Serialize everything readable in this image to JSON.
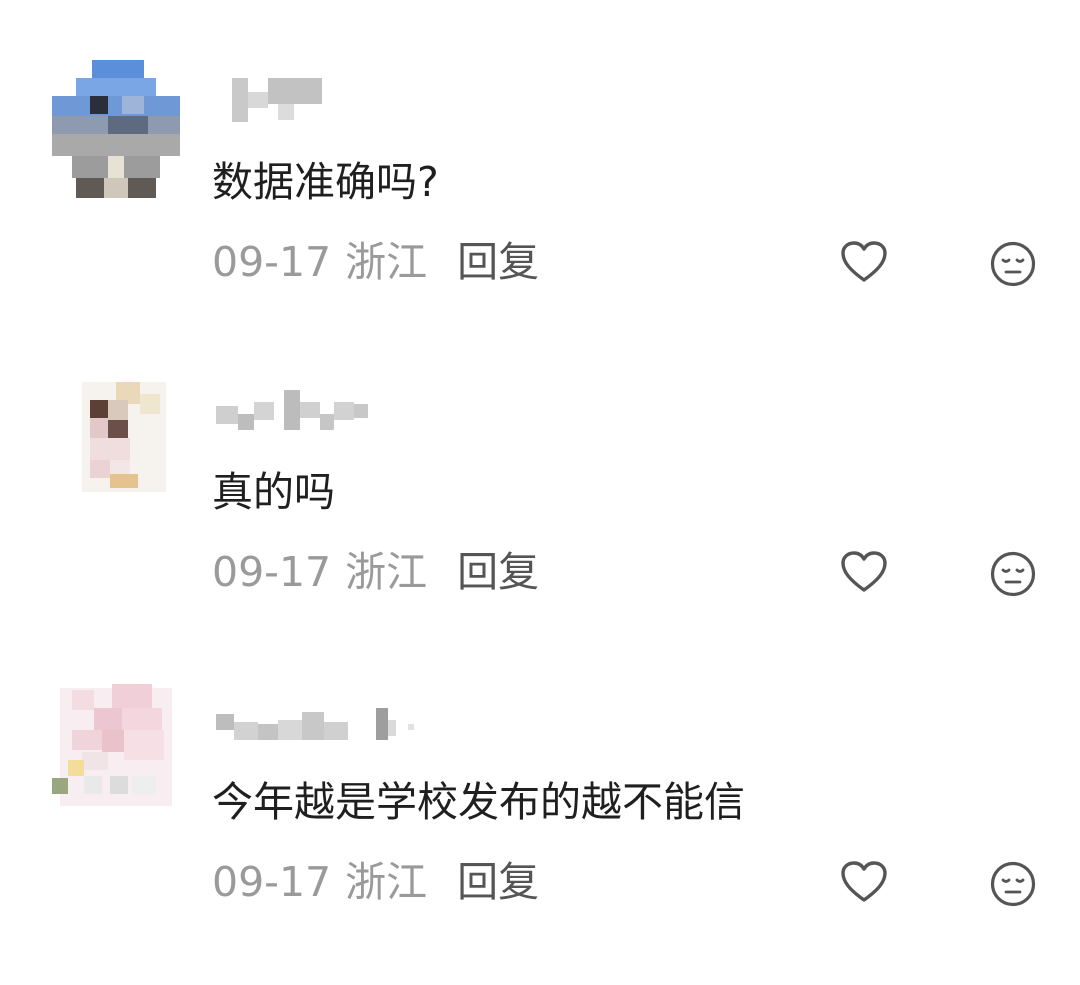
{
  "comments": [
    {
      "username": "",
      "text": "数据准确吗?",
      "date": "09-17",
      "location": "浙江",
      "reply_label": "回复",
      "like_icon": "heart-outline-icon",
      "dislike_icon": "unamused-face-icon"
    },
    {
      "username": "",
      "text": "真的吗",
      "date": "09-17",
      "location": "浙江",
      "reply_label": "回复",
      "like_icon": "heart-outline-icon",
      "dislike_icon": "unamused-face-icon"
    },
    {
      "username": "",
      "text": "今年越是学校发布的越不能信",
      "date": "09-17",
      "location": "浙江",
      "reply_label": "回复",
      "like_icon": "heart-outline-icon",
      "dislike_icon": "unamused-face-icon"
    }
  ],
  "colors": {
    "text": "#1f1f1f",
    "meta": "#9a9a9a",
    "reply": "#555555",
    "icon": "#555555"
  }
}
